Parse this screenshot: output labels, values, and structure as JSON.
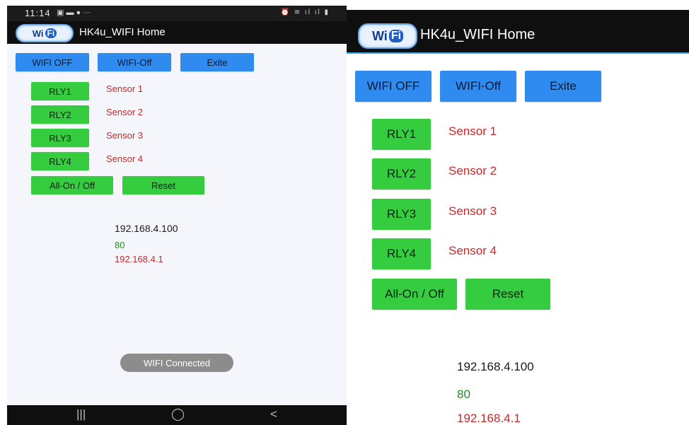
{
  "status_bar": {
    "time": "11:14",
    "icons_left": "▣ ▬ ● ···",
    "icons_right": "⏰ ≋ ıl ıl ▮"
  },
  "app": {
    "title": "HK4u_WIFI Home",
    "logo_wi": "Wi",
    "logo_fi": "Fi"
  },
  "top_buttons": {
    "wifi_off": "WIFI OFF",
    "wifi_off2": "WIFI-Off",
    "exit": "Exite"
  },
  "relays": [
    {
      "button": "RLY1",
      "sensor": "Sensor 1"
    },
    {
      "button": "RLY2",
      "sensor": "Sensor 2"
    },
    {
      "button": "RLY3",
      "sensor": "Sensor 3"
    },
    {
      "button": "RLY4",
      "sensor": "Sensor 4"
    }
  ],
  "controls": {
    "all_on_off": "All-On / Off",
    "reset": "Reset"
  },
  "network": {
    "ip": "192.168.4.100",
    "port": "80",
    "gateway": "192.168.4.1"
  },
  "toast": "WIFI Connected",
  "nav": {
    "recent": "|||",
    "home": "◯",
    "back": "<"
  },
  "colors": {
    "blue_button": "#2f8bf0",
    "green_button": "#35cc3f",
    "sensor_text": "#c62a2a",
    "port_text": "#238a23",
    "app_bar": "#0f0f0f"
  }
}
